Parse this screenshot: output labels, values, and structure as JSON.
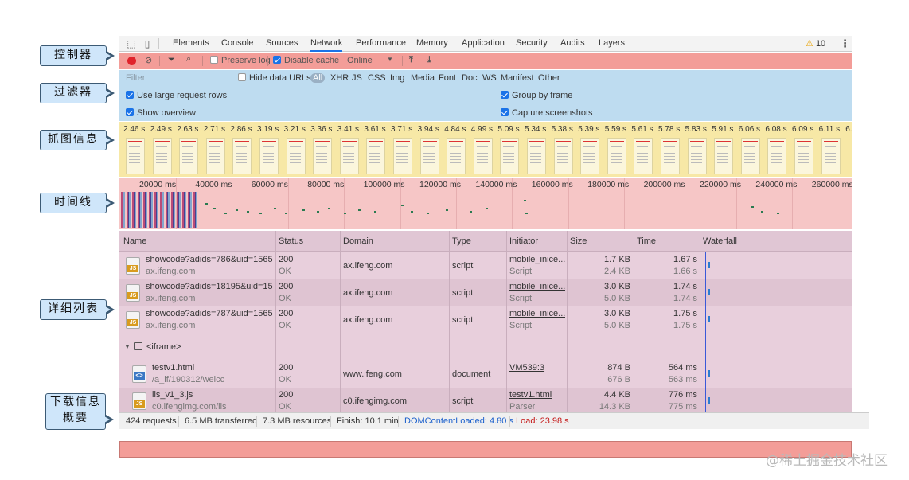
{
  "tabs": [
    "Elements",
    "Console",
    "Sources",
    "Network",
    "Performance",
    "Memory",
    "Application",
    "Security",
    "Audits",
    "Layers"
  ],
  "active_tab": "Network",
  "warnings": "10",
  "controls": {
    "preserve_log": "Preserve log",
    "disable_cache": "Disable cache",
    "throttle": "Online"
  },
  "filter": {
    "placeholder": "Filter",
    "hide_data_urls": "Hide data URLs",
    "types": [
      "All",
      "XHR",
      "JS",
      "CSS",
      "Img",
      "Media",
      "Font",
      "Doc",
      "WS",
      "Manifest",
      "Other"
    ]
  },
  "options": {
    "use_large_rows": "Use large request rows",
    "group_by_frame": "Group by frame",
    "show_overview": "Show overview",
    "capture_screenshots": "Capture screenshots"
  },
  "screenshot_times": [
    "2.46 s",
    "2.49 s",
    "2.63 s",
    "2.71 s",
    "2.86 s",
    "3.19 s",
    "3.21 s",
    "3.36 s",
    "3.41 s",
    "3.61 s",
    "3.71 s",
    "3.94 s",
    "4.84 s",
    "4.99 s",
    "5.09 s",
    "5.34 s",
    "5.38 s",
    "5.39 s",
    "5.59 s",
    "5.61 s",
    "5.78 s",
    "5.83 s",
    "5.91 s",
    "6.06 s",
    "6.08 s",
    "6.09 s",
    "6.11 s",
    "6."
  ],
  "timeline_ticks": [
    "20000 ms",
    "40000 ms",
    "60000 ms",
    "80000 ms",
    "100000 ms",
    "120000 ms",
    "140000 ms",
    "160000 ms",
    "180000 ms",
    "200000 ms",
    "220000 ms",
    "240000 ms",
    "260000 ms"
  ],
  "columns": [
    "Name",
    "Status",
    "Domain",
    "Type",
    "Initiator",
    "Size",
    "Time",
    "Waterfall"
  ],
  "rows": [
    {
      "name": "showcode?adids=786&uid=1565...",
      "path": "ax.ifeng.com",
      "status": "200",
      "status_text": "OK",
      "domain": "ax.ifeng.com",
      "type": "script",
      "initiator": "mobile_inice...",
      "initiator_type": "Script",
      "size1": "1.7 KB",
      "size2": "2.4 KB",
      "time1": "1.67 s",
      "time2": "1.66 s",
      "icon": "JS"
    },
    {
      "name": "showcode?adids=18195&uid=15...",
      "path": "ax.ifeng.com",
      "status": "200",
      "status_text": "OK",
      "domain": "ax.ifeng.com",
      "type": "script",
      "initiator": "mobile_inice...",
      "initiator_type": "Script",
      "size1": "3.0 KB",
      "size2": "5.0 KB",
      "time1": "1.74 s",
      "time2": "1.74 s",
      "icon": "JS"
    },
    {
      "name": "showcode?adids=787&uid=1565...",
      "path": "ax.ifeng.com",
      "status": "200",
      "status_text": "OK",
      "domain": "ax.ifeng.com",
      "type": "script",
      "initiator": "mobile_inice...",
      "initiator_type": "Script",
      "size1": "3.0 KB",
      "size2": "5.0 KB",
      "time1": "1.75 s",
      "time2": "1.75 s",
      "icon": "JS"
    }
  ],
  "frame_group": "<iframe>",
  "frame_rows": [
    {
      "name": "testv1.html",
      "path": "/a_if/190312/weicc",
      "status": "200",
      "status_text": "OK",
      "domain": "www.ifeng.com",
      "type": "document",
      "initiator": "VM539:3",
      "initiator_type": "",
      "size1": "874 B",
      "size2": "676 B",
      "time1": "564 ms",
      "time2": "563 ms",
      "icon": "<>"
    },
    {
      "name": "iis_v1_3.js",
      "path": "c0.ifengimg.com/iis",
      "status": "200",
      "status_text": "OK",
      "domain": "c0.ifengimg.com",
      "type": "script",
      "initiator": "testv1.html",
      "initiator_type": "Parser",
      "size1": "4.4 KB",
      "size2": "14.3 KB",
      "time1": "776 ms",
      "time2": "775 ms",
      "icon": "JS"
    }
  ],
  "summary": {
    "requests": "424 requests",
    "transferred": "6.5 MB transferred",
    "resources": "7.3 MB resources",
    "finish": "Finish: 10.1 min",
    "dcl": "DOMContentLoaded: 4.80 s",
    "load": "Load: 23.98 s"
  },
  "callouts": {
    "controller": "控制器",
    "filter": "过滤器",
    "screenshots": "抓图信息",
    "timeline": "时间线",
    "detail_list": "详细列表",
    "download_summary_1": "下载信息",
    "download_summary_2": "概要"
  },
  "watermark": "@稀土掘金技术社区",
  "colors": {
    "control_bar": "#f39d98",
    "filter_bar": "#bedcf0",
    "screenshot_strip": "#f7e8a6",
    "timeline": "#f6c6c6",
    "table": "#e8cfdc",
    "callout": "#cfe6fa",
    "record": "#e0232b"
  }
}
